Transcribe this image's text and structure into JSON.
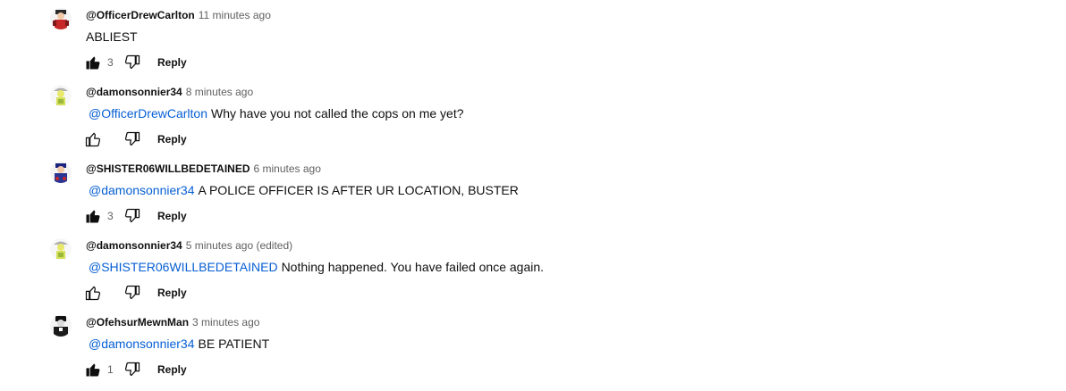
{
  "comments": [
    {
      "author": "@OfficerDrewCarlton",
      "time": "11 minutes ago",
      "mention": "",
      "text": "ABLIEST",
      "likes": "3",
      "liked": true,
      "reply_label": "Reply",
      "avatar": "officer-red-avatar"
    },
    {
      "author": "@damonsonnier34",
      "time": "8 minutes ago",
      "mention": "@OfficerDrewCarlton",
      "text": "Why have you not called the cops on me yet?",
      "likes": "",
      "liked": false,
      "reply_label": "Reply",
      "avatar": "yellow-character-avatar"
    },
    {
      "author": "@SHISTER06WILLBEDETAINED",
      "time": "6 minutes ago",
      "mention": "@damonsonnier34",
      "text": "A POLICE OFFICER IS AFTER UR LOCATION, BUSTER",
      "likes": "3",
      "liked": true,
      "reply_label": "Reply",
      "avatar": "police-blue-avatar"
    },
    {
      "author": "@damonsonnier34",
      "time": "5 minutes ago (edited)",
      "mention": "@SHISTER06WILLBEDETAINED",
      "text": "Nothing happened. You have failed once again.",
      "likes": "",
      "liked": false,
      "reply_label": "Reply",
      "avatar": "yellow-character-avatar"
    },
    {
      "author": "@OfehsurMewnMan",
      "time": "3 minutes ago",
      "mention": "@damonsonnier34",
      "text": "BE PATIENT",
      "likes": "1",
      "liked": true,
      "reply_label": "Reply",
      "avatar": "black-officer-avatar"
    }
  ],
  "colors": {
    "mention": "#065fd4",
    "meta": "#606060",
    "text": "#0f0f0f"
  }
}
